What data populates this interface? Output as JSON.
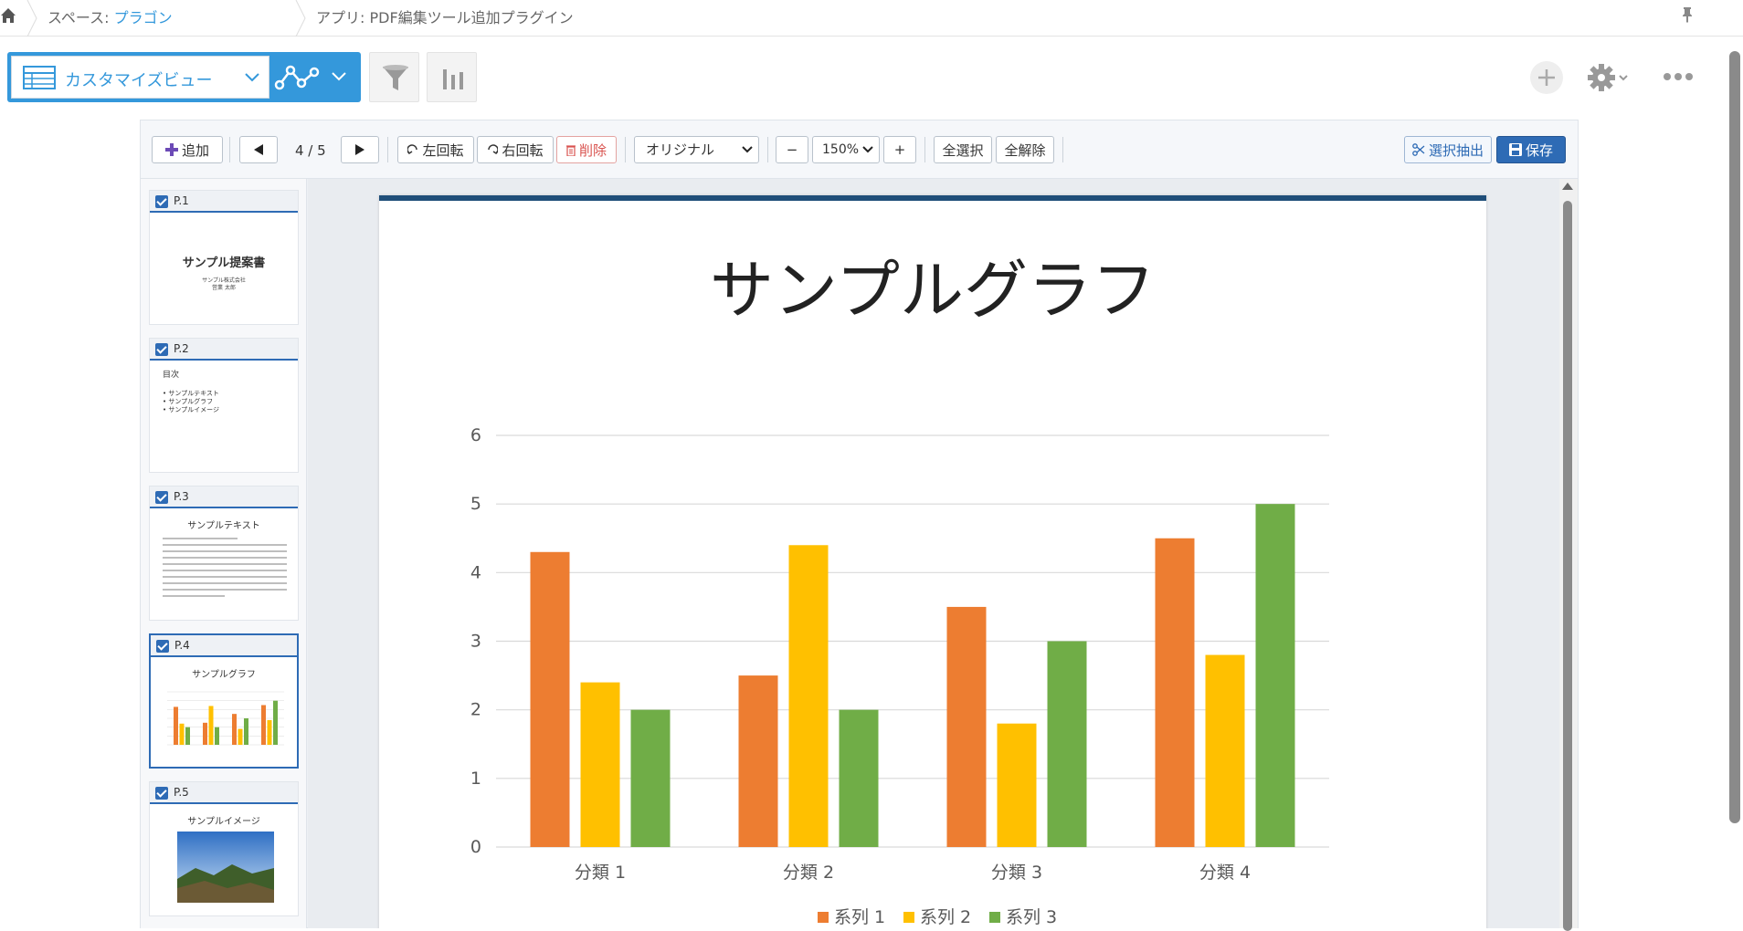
{
  "breadcrumb": {
    "space_prefix": "スペース: ",
    "space_link": "プラゴン",
    "app": "アプリ: PDF編集ツール追加プラグイン"
  },
  "view_selector": {
    "label": "カスタマイズビュー"
  },
  "editor_toolbar": {
    "add": "追加",
    "page_indicator": "4 / 5",
    "rotate_left": "左回転",
    "rotate_right": "右回転",
    "delete": "削除",
    "size_mode": "オリジナル",
    "zoom_out": "−",
    "zoom": "150%",
    "zoom_in": "+",
    "select_all": "全選択",
    "deselect_all": "全解除",
    "extract_selected": "選択抽出",
    "save": "保存"
  },
  "thumbnails": [
    {
      "label": "P.1",
      "title": "サンプル提案書",
      "sub1": "サンプル株式会社",
      "sub2": "営業 太郎"
    },
    {
      "label": "P.2",
      "title": "目次",
      "items": [
        "• サンプルテキスト",
        "• サンプルグラフ",
        "• サンプルイメージ"
      ]
    },
    {
      "label": "P.3",
      "title": "サンプルテキスト"
    },
    {
      "label": "P.4",
      "title": "サンプルグラフ"
    },
    {
      "label": "P.5",
      "title": "サンプルイメージ"
    }
  ],
  "page": {
    "title": "サンプルグラフ"
  },
  "chart_data": {
    "type": "bar",
    "title": "サンプルグラフ",
    "categories": [
      "分類 1",
      "分類 2",
      "分類 3",
      "分類 4"
    ],
    "series": [
      {
        "name": "系列 1",
        "color": "#ED7D31",
        "values": [
          4.3,
          2.5,
          3.5,
          4.5
        ]
      },
      {
        "name": "系列 2",
        "color": "#FFC000",
        "values": [
          2.4,
          4.4,
          1.8,
          2.8
        ]
      },
      {
        "name": "系列 3",
        "color": "#70AD47",
        "values": [
          2,
          2,
          3,
          5
        ]
      }
    ],
    "ylim": [
      0,
      6
    ],
    "yticks": [
      "0",
      "1",
      "2",
      "3",
      "4",
      "5",
      "6"
    ],
    "grid": true,
    "legend": "bottom"
  },
  "colors": {
    "accent": "#3498db",
    "primary": "#2e6bb5",
    "danger": "#d9534f"
  }
}
